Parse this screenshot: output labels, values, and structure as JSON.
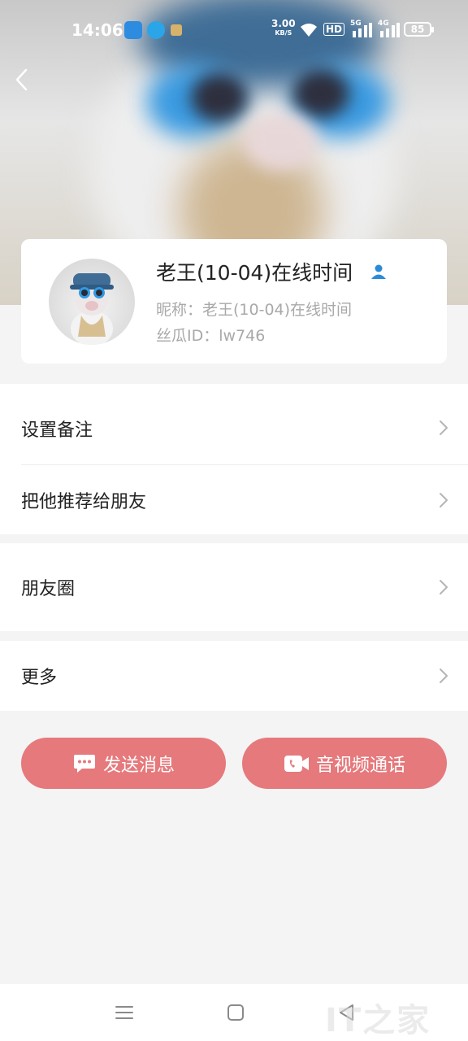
{
  "status_bar": {
    "time": "14:06",
    "net_speed_value": "3.00",
    "net_speed_unit": "KB/S",
    "hd_label": "HD",
    "sim1_label": "5G",
    "sim2_label": "4G",
    "battery": "85"
  },
  "profile": {
    "name": "老王(10-04)在线时间",
    "nickname_line": "昵称：老王(10-04)在线时间",
    "id_line": "丝瓜ID：lw746"
  },
  "menu": {
    "set_remark": "设置备注",
    "recommend": "把他推荐给朋友",
    "moments": "朋友圈",
    "more": "更多"
  },
  "actions": {
    "send_message": "发送消息",
    "av_call": "音视频通话"
  },
  "watermark": "IT之家",
  "colors": {
    "accent_button": "#e6797c",
    "contact_icon": "#2a8bd6"
  }
}
